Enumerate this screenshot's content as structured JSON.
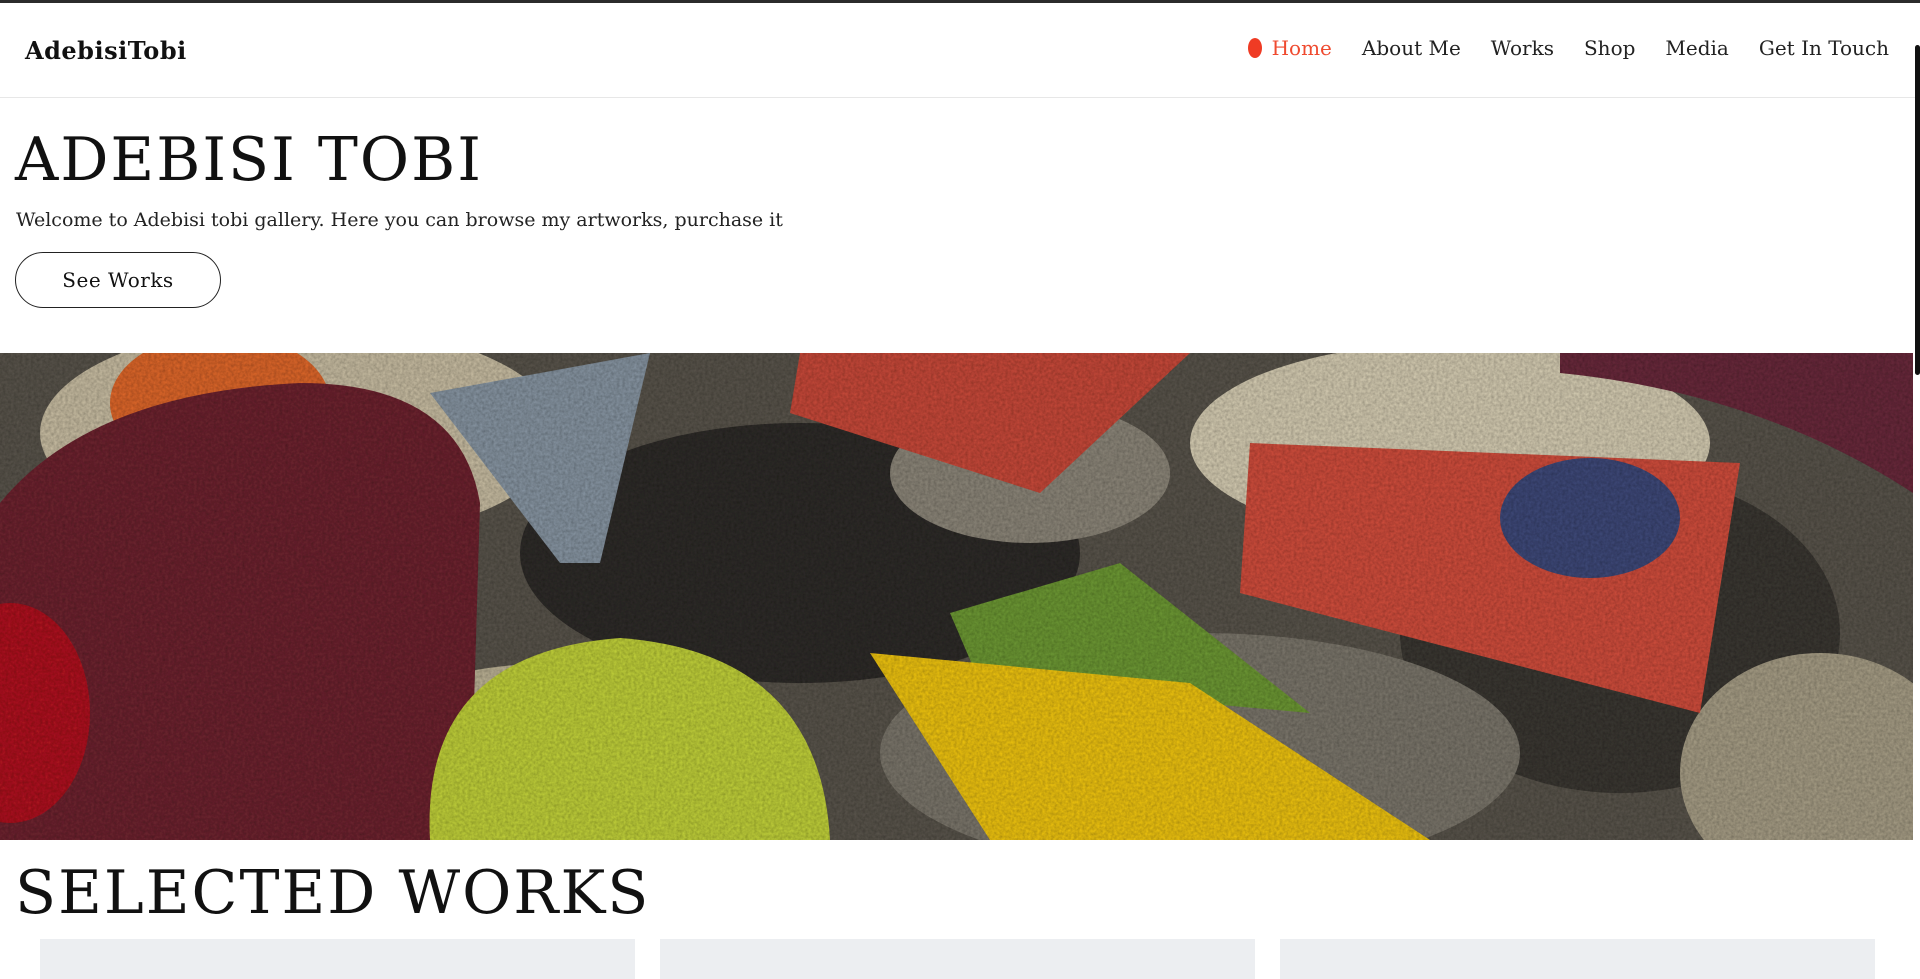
{
  "header": {
    "brand": "AdebisiTobi",
    "nav": [
      {
        "label": "Home",
        "active": true
      },
      {
        "label": "About Me",
        "active": false
      },
      {
        "label": "Works",
        "active": false
      },
      {
        "label": "Shop",
        "active": false
      },
      {
        "label": "Media",
        "active": false
      },
      {
        "label": "Get In Touch",
        "active": false
      }
    ]
  },
  "hero": {
    "title": "ADEBISI TOBI",
    "subtitle": "Welcome to Adebisi tobi gallery. Here you can browse my artworks, purchase it",
    "cta_label": "See Works"
  },
  "banner": {
    "image_alt": "textile-artwork-banner"
  },
  "selected_works": {
    "title": "SELECTED WORKS",
    "cards": [
      {},
      {},
      {}
    ]
  },
  "colors": {
    "accent": "#ef4a2f",
    "text": "#111111",
    "card_bg": "#eceef1"
  }
}
